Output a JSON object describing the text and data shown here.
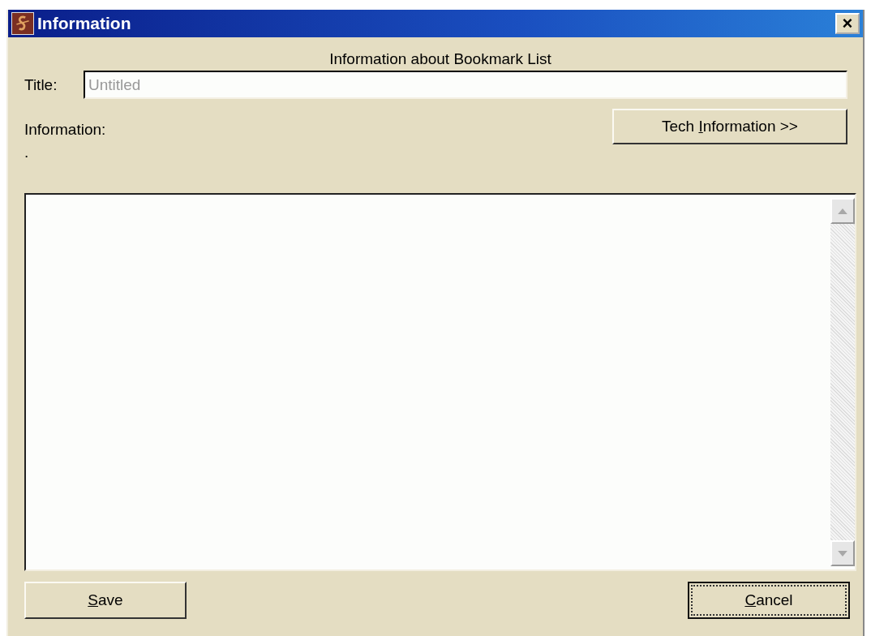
{
  "window": {
    "title": "Information",
    "close_label": "×"
  },
  "heading": "Information about Bookmark List",
  "title_field": {
    "label": "Title:",
    "placeholder": "Untitled"
  },
  "information_label": "Information:",
  "tech_button": {
    "before": "Tech ",
    "access_key": "I",
    "after": "nformation >>"
  },
  "information_text": ".",
  "buttons": [
    {
      "access_key": "S",
      "after": "ave",
      "focused": false
    },
    {
      "access_key": "C",
      "after": "ancel",
      "focused": true
    }
  ]
}
